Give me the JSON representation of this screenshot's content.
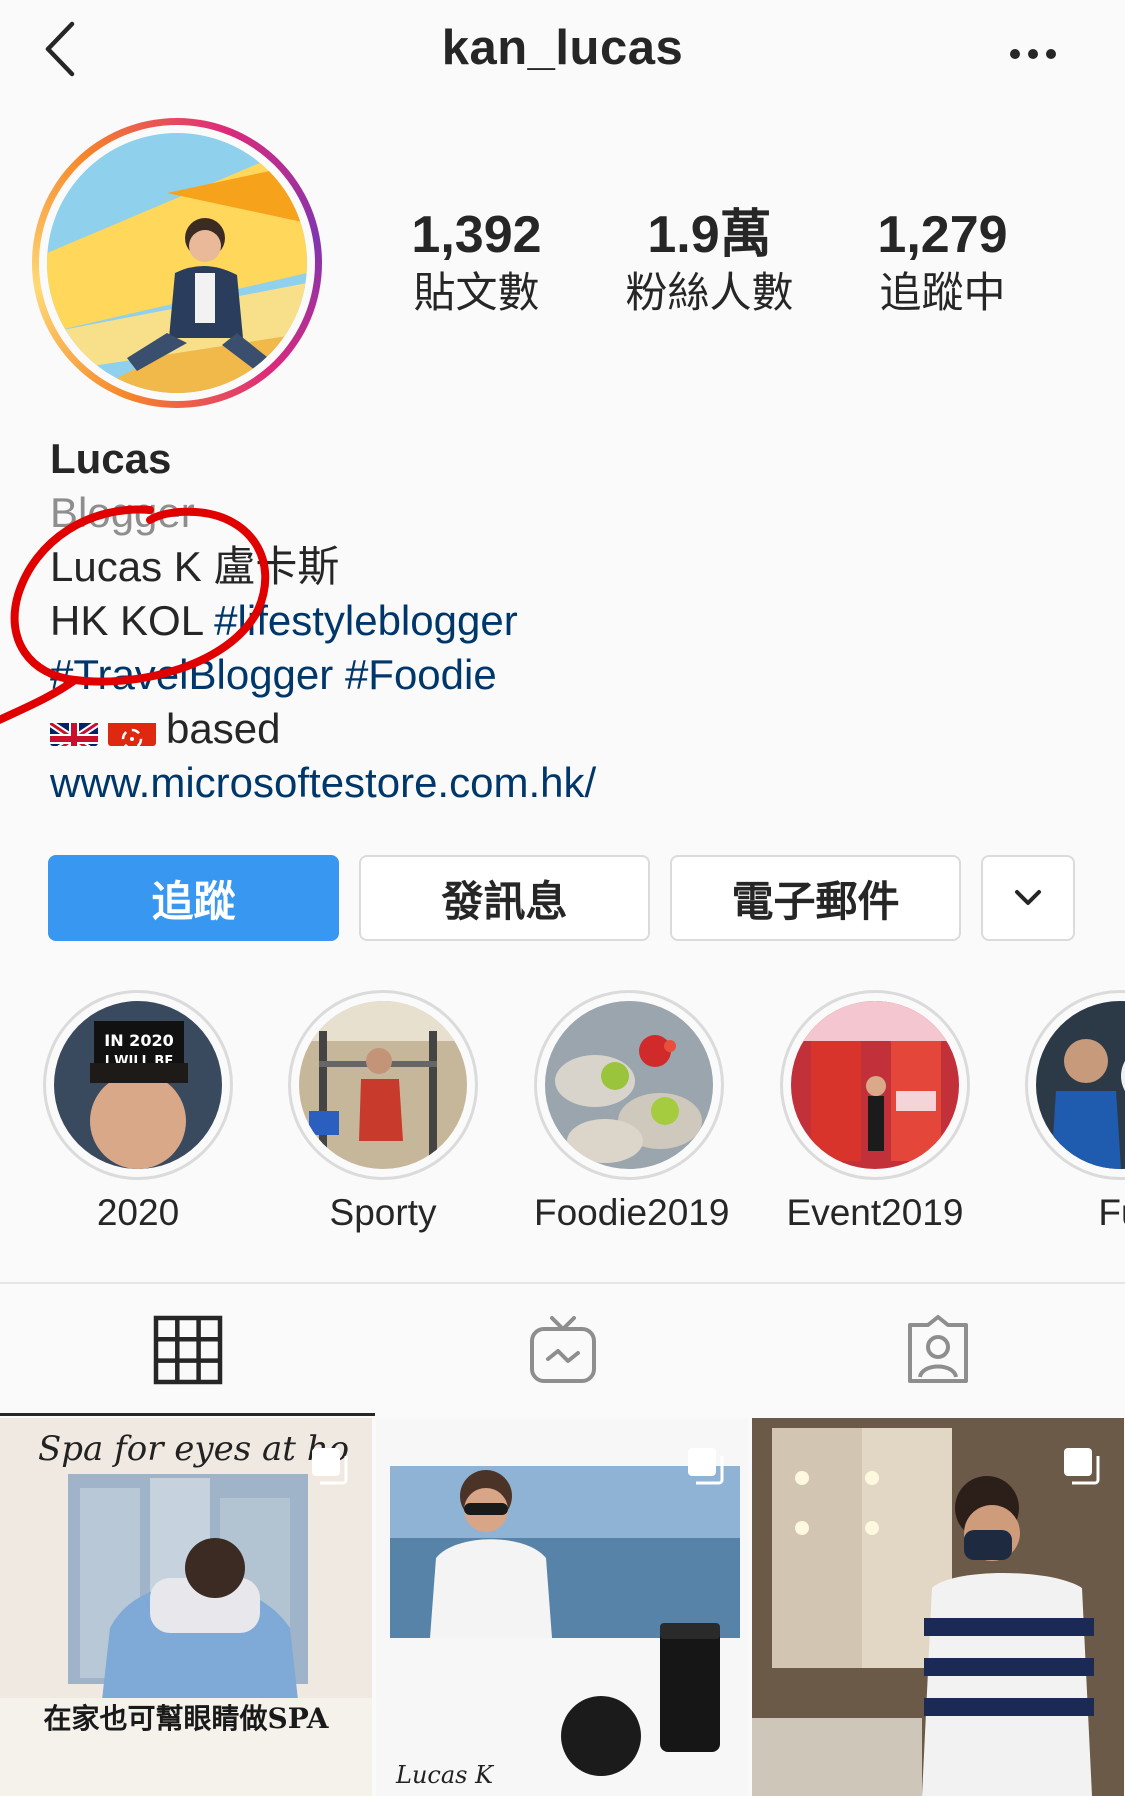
{
  "header": {
    "username": "kan_lucas",
    "back_icon": "chevron-left-icon",
    "more_icon": "more-horizontal-icon"
  },
  "stats": [
    {
      "value": "1,392",
      "label": "貼文數"
    },
    {
      "value": "1.9萬",
      "label": "粉絲人數"
    },
    {
      "value": "1,279",
      "label": "追蹤中"
    }
  ],
  "bio": {
    "name": "Lucas",
    "category": "Blogger",
    "line1": "Lucas K 盧卡斯",
    "line2_text": "HK KOL ",
    "hashtag1": "#lifestyleblogger",
    "hashtag2": "#TravelBlogger",
    "hashtag3": "#Foodie",
    "based": "based",
    "link": "www.microsoftestore.com.hk/"
  },
  "actions": {
    "follow": "追蹤",
    "message": "發訊息",
    "email": "電子郵件",
    "more_icon": "chevron-down-icon"
  },
  "highlights": [
    {
      "label": "2020",
      "badge": "IN 2020\nI WILL BE"
    },
    {
      "label": "Sporty"
    },
    {
      "label": "Foodie2019"
    },
    {
      "label": "Event2019"
    },
    {
      "label": "Fu"
    }
  ],
  "tabs": [
    {
      "icon": "grid-icon",
      "active": true
    },
    {
      "icon": "igtv-icon",
      "active": false
    },
    {
      "icon": "tagged-icon",
      "active": false
    }
  ],
  "posts": [
    {
      "script_title": "Spa for eyes at ho",
      "caption": "在家也可幫眼睛做SPA"
    },
    {
      "signature": "Lucas K"
    },
    {}
  ],
  "colors": {
    "follow_button": "#3897f0",
    "hashtag": "#00376b",
    "annotation": "#e00000"
  }
}
